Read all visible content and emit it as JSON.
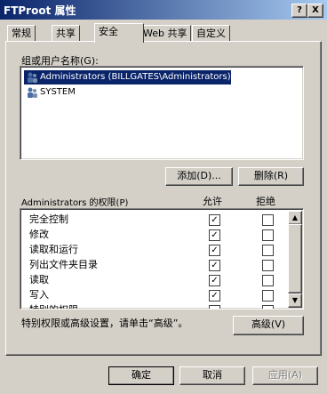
{
  "window": {
    "title": "FTProot 属性",
    "help_btn": "?",
    "close_btn": "X"
  },
  "tabs": [
    {
      "label": "常规"
    },
    {
      "label": "共享"
    },
    {
      "label": "安全"
    },
    {
      "label": "Web 共享"
    },
    {
      "label": "自定义"
    }
  ],
  "users": {
    "label": "组或用户名称(G):",
    "items": [
      {
        "name": "Administrators (BILLGATES\\Administrators)",
        "selected": true
      },
      {
        "name": "SYSTEM",
        "selected": false
      }
    ],
    "add_btn": "添加(D)...",
    "remove_btn": "删除(R)"
  },
  "permissions": {
    "label": "Administrators 的权限(P)",
    "allow_header": "允许",
    "deny_header": "拒绝",
    "rows": [
      {
        "name": "完全控制",
        "allow": true,
        "deny": false
      },
      {
        "name": "修改",
        "allow": true,
        "deny": false
      },
      {
        "name": "读取和运行",
        "allow": true,
        "deny": false
      },
      {
        "name": "列出文件夹目录",
        "allow": true,
        "deny": false
      },
      {
        "name": "读取",
        "allow": true,
        "deny": false
      },
      {
        "name": "写入",
        "allow": true,
        "deny": false
      },
      {
        "name": "特别的权限",
        "allow": false,
        "deny": false
      }
    ]
  },
  "advanced": {
    "text": "特别权限或高级设置，请单击“高级”。",
    "btn": "高级(V)"
  },
  "footer": {
    "ok": "确定",
    "cancel": "取消",
    "apply": "应用(A)"
  },
  "colors": {
    "selection": "#0a246a",
    "face": "#d4d0c8"
  }
}
